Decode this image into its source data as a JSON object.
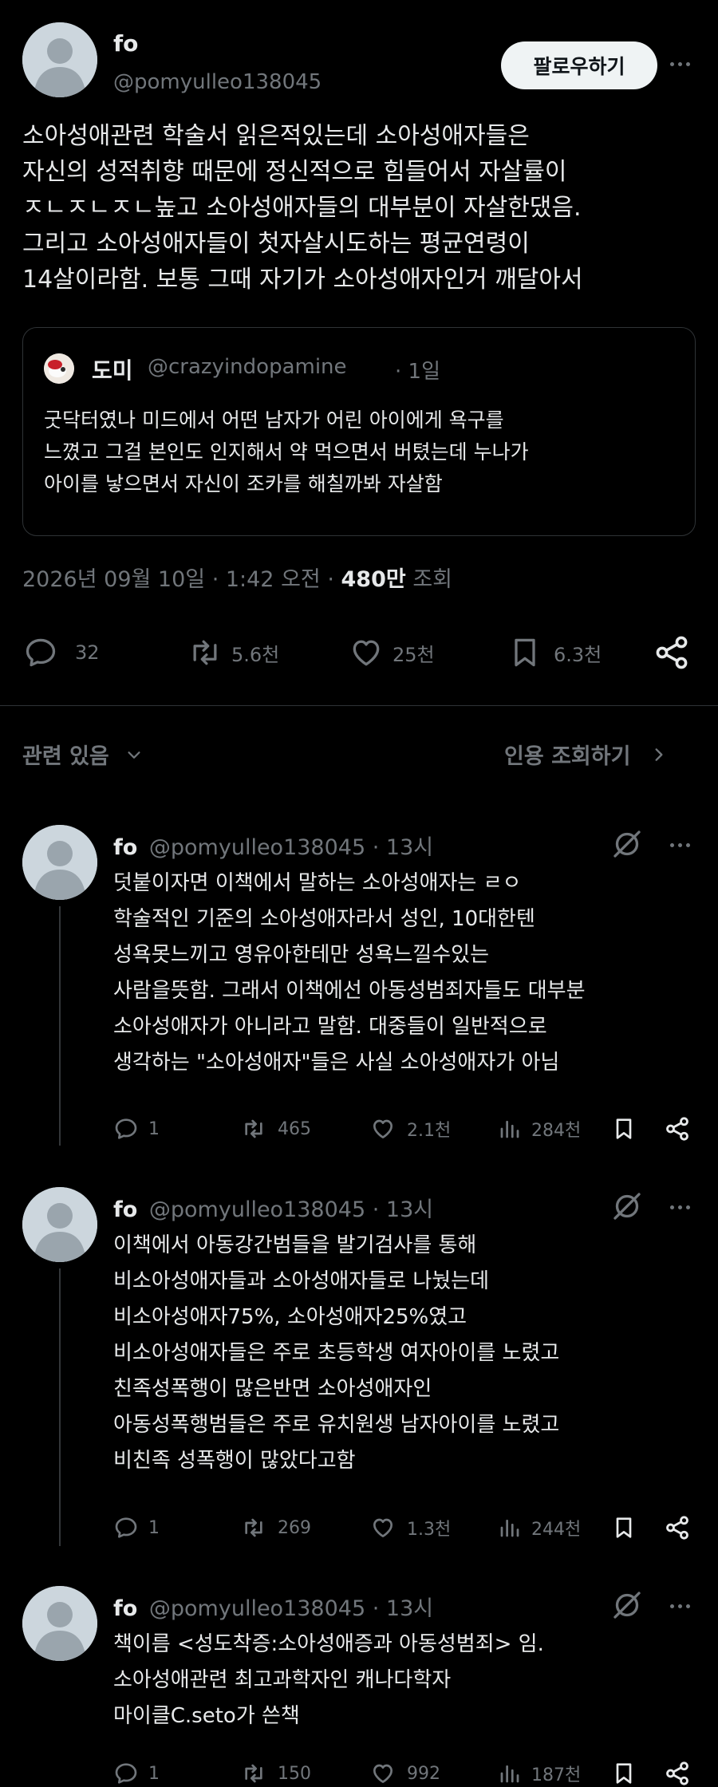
{
  "post": {
    "author_name": "fo",
    "author_handle": "@pomyulleo138045",
    "follow_label": "팔로우하기",
    "text": "소아성애관련 학술서 읽은적있는데 소아성애자들은\n자신의 성적취향 때문에 정신적으로 힘들어서 자살률이\nㅈㄴㅈㄴㅈㄴ높고 소아성애자들의 대부분이 자살한댔음.\n그리고 소아성애자들이 첫자살시도하는 평균연령이\n14살이라함. 보통 그때 자기가 소아성애자인거 깨달아서",
    "quote": {
      "author_name": "도미",
      "author_handle": "@crazyindopamine",
      "time": "· 1일",
      "text": "굿닥터였나 미드에서 어떤 남자가 어린 아이에게 욕구를\n느꼈고 그걸 본인도 인지해서 약 먹으면서 버텼는데 누나가\n아이를 낳으면서 자신이 조카를 해칠까봐 자살함"
    },
    "meta": {
      "date": "2026년 09월 10일 · 1:42 오전 ·",
      "views_count": "480만",
      "views_label": "조회"
    },
    "actions": {
      "replies": "32",
      "retweets": "5.6천",
      "likes": "25천",
      "bookmarks": "6.3천"
    }
  },
  "related": {
    "left_label": "관련 있음",
    "right_label": "인용 조회하기"
  },
  "replies": [
    {
      "author_name": "fo",
      "author_handle": "@pomyulleo138045",
      "time": "· 13시",
      "text": "덧붙이자면 이책에서 말하는 소아성애자는 ㄹㅇ\n학술적인 기준의 소아성애자라서 성인, 10대한텐\n성욕못느끼고 영유아한테만 성욕느낄수있는\n사람을뜻함. 그래서 이책에선 아동성범죄자들도 대부분\n소아성애자가 아니라고 말함. 대중들이 일반적으로\n생각하는 \"소아성애자\"들은 사실 소아성애자가 아님",
      "replies": "1",
      "retweets": "465",
      "likes": "2.1천",
      "views": "284천"
    },
    {
      "author_name": "fo",
      "author_handle": "@pomyulleo138045",
      "time": "· 13시",
      "text": "이책에서 아동강간범들을 발기검사를 통해\n비소아성애자들과 소아성애자들로 나눴는데\n비소아성애자75%, 소아성애자25%였고\n비소아성애자들은 주로 초등학생 여자아이를 노렸고\n친족성폭행이 많은반면 소아성애자인\n아동성폭행범들은 주로 유치원생 남자아이를 노렸고\n비친족 성폭행이 많았다고함",
      "replies": "1",
      "retweets": "269",
      "likes": "1.3천",
      "views": "244천"
    },
    {
      "author_name": "fo",
      "author_handle": "@pomyulleo138045",
      "time": "· 13시",
      "text": "책이름 <성도착증:소아성애증과 아동성범죄> 임.\n소아성애관련 최고과학자인 캐나다학자\n마이클C.seto가 쓴책",
      "replies": "1",
      "retweets": "150",
      "likes": "992",
      "views": "187천"
    }
  ],
  "colors": {
    "background": "#000000",
    "text": "#e7e9ea",
    "muted": "#71767b",
    "border": "#2f3336"
  }
}
